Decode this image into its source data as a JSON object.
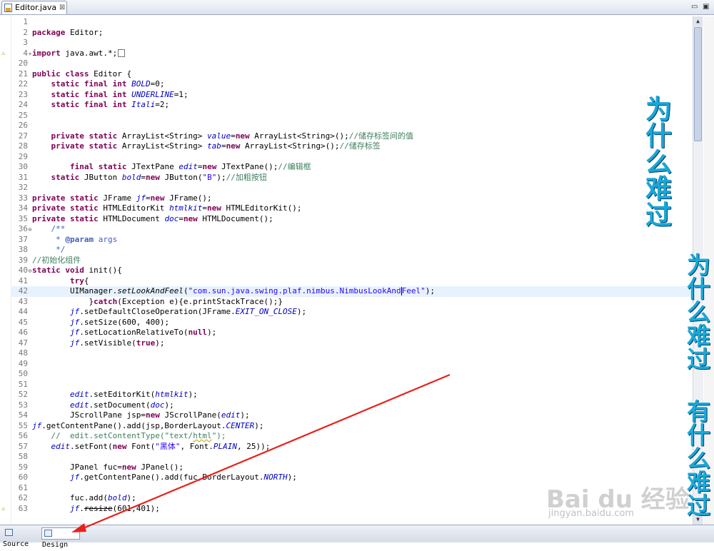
{
  "tab": {
    "title": "Editor.java",
    "close": "⊠"
  },
  "window_controls": {
    "minimize": "▭",
    "maximize": "▣"
  },
  "code_lines": [
    {
      "n": "1",
      "html": ""
    },
    {
      "n": "2",
      "html": "<span class=\"kw\">package</span> Editor;"
    },
    {
      "n": "3",
      "html": ""
    },
    {
      "n": "4",
      "fold": "+",
      "marker": "⚠",
      "html": "<span class=\"kw\">import</span> java.awt.*;<span class=\"foldbox\"></span>"
    },
    {
      "n": "20",
      "html": ""
    },
    {
      "n": "21",
      "html": "<span class=\"kw\">public class</span> Editor {"
    },
    {
      "n": "22",
      "html": "    <span class=\"kw\">static final int</span> <span class=\"sf\">BOLD</span>=0;"
    },
    {
      "n": "23",
      "html": "    <span class=\"kw\">static final int</span> <span class=\"sf\">UNDERLINE</span>=1;"
    },
    {
      "n": "24",
      "html": "    <span class=\"kw\">static final int</span> <span class=\"sf\">Itali</span>=2;"
    },
    {
      "n": "25",
      "html": ""
    },
    {
      "n": "26",
      "html": ""
    },
    {
      "n": "27",
      "html": "    <span class=\"kw\">private static</span> ArrayList&lt;String&gt; <span class=\"sf\">value</span>=<span class=\"kw\">new</span> ArrayList&lt;String&gt;();<span class=\"cm\">//储存标签间的值</span>"
    },
    {
      "n": "28",
      "html": "    <span class=\"kw\">private static</span> ArrayList&lt;String&gt; <span class=\"sf\">tab</span>=<span class=\"kw\">new</span> ArrayList&lt;String&gt;();<span class=\"cm\">//储存标签</span>"
    },
    {
      "n": "29",
      "html": ""
    },
    {
      "n": "30",
      "html": "        <span class=\"kw\">final static</span> JTextPane <span class=\"sf\">edit</span>=<span class=\"kw\">new</span> JTextPane();<span class=\"cm\">//编辑框</span>"
    },
    {
      "n": "31",
      "html": "    <span class=\"kw\">static</span> JButton <span class=\"sf\">bold</span>=<span class=\"kw\">new</span> JButton(<span class=\"str\">\"B\"</span>);<span class=\"cm\">//加粗按钮</span>"
    },
    {
      "n": "32",
      "html": ""
    },
    {
      "n": "33",
      "html": "<span class=\"kw\">private static</span> JFrame <span class=\"sf\">jf</span>=<span class=\"kw\">new</span> JFrame();"
    },
    {
      "n": "34",
      "html": "<span class=\"kw\">private static</span> HTMLEditorKit <span class=\"sf\">htmlkit</span>=<span class=\"kw\">new</span> HTMLEditorKit();"
    },
    {
      "n": "35",
      "html": "<span class=\"kw\">private static</span> HTMLDocument <span class=\"sf\">doc</span>=<span class=\"kw\">new</span> HTMLDocument();"
    },
    {
      "n": "36",
      "fold": "⊖",
      "html": "    <span class=\"jd\">/**</span>"
    },
    {
      "n": "37",
      "html": "     <span class=\"jd\">* <b>@param</b> args</span>"
    },
    {
      "n": "38",
      "html": "     <span class=\"jd\">*/</span>"
    },
    {
      "n": "39",
      "html": "<span class=\"cm\">//初始化组件</span>"
    },
    {
      "n": "40",
      "fold": "⊖",
      "html": "<span class=\"kw\">static void</span> init(){"
    },
    {
      "n": "41",
      "html": "        <span class=\"kw\">try</span>{"
    },
    {
      "n": "42",
      "cur": true,
      "html": "        UIManager.<i>setLookAndFeel</i>(<span class=\"str\">\"com.sun.java.swing.plaf.nimbus.NimbusLookAnd<span class=\"caret\"></span>Feel\"</span>);"
    },
    {
      "n": "43",
      "html": "            }<span class=\"kw\">catch</span>(Exception e){e.printStackTrace();}"
    },
    {
      "n": "44",
      "html": "        <span class=\"sf\">jf</span>.setDefaultCloseOperation(JFrame.<span class=\"sf\">EXIT_ON_CLOSE</span>);"
    },
    {
      "n": "45",
      "html": "        <span class=\"sf\">jf</span>.setSize(600, 400);"
    },
    {
      "n": "46",
      "html": "        <span class=\"sf\">jf</span>.setLocationRelativeTo(<span class=\"kw\">null</span>);"
    },
    {
      "n": "47",
      "html": "        <span class=\"sf\">jf</span>.setVisible(<span class=\"kw\">true</span>);"
    },
    {
      "n": "48",
      "html": ""
    },
    {
      "n": "49",
      "html": ""
    },
    {
      "n": "50",
      "html": ""
    },
    {
      "n": "51",
      "html": ""
    },
    {
      "n": "52",
      "html": "        <span class=\"sf\">edit</span>.setEditorKit(<span class=\"sf\">htmlkit</span>);"
    },
    {
      "n": "53",
      "html": "        <span class=\"sf\">edit</span>.setDocument(<span class=\"sf\">doc</span>);"
    },
    {
      "n": "54",
      "html": "        JScrollPane jsp=<span class=\"kw\">new</span> JScrollPane(<span class=\"sf\">edit</span>);"
    },
    {
      "n": "55",
      "html": "<span class=\"sf\">jf</span>.getContentPane().add(jsp,BorderLayout.<span class=\"sf\">CENTER</span>);"
    },
    {
      "n": "56",
      "html": "    <span class=\"cm\">//  edit.setContentType(\"text/<span class=\"warn\">html</span>\");</span>"
    },
    {
      "n": "57",
      "html": "    <span class=\"sf\">edit</span>.setFont(<span class=\"kw\">new</span> Font(<span class=\"str\">\"黑体\"</span>, Font.<span class=\"sf\">PLAIN</span>, 25));"
    },
    {
      "n": "58",
      "html": ""
    },
    {
      "n": "59",
      "html": "        JPanel fuc=<span class=\"kw\">new</span> JPanel();"
    },
    {
      "n": "60",
      "html": "        <span class=\"sf\">jf</span>.getContentPane().add(fuc,BorderLayout.<span class=\"sf\">NORTH</span>);"
    },
    {
      "n": "61",
      "html": ""
    },
    {
      "n": "62",
      "html": "        fuc.add(<span class=\"sf\">bold</span>);"
    },
    {
      "n": "63",
      "marker": "⚠",
      "html": "        <span class=\"sf\">jf</span>.<span class=\"strike warn\">resize</span>(601,401);"
    }
  ],
  "bottom_tabs": [
    {
      "label": "Source",
      "active": false
    },
    {
      "label": "Design",
      "active": true
    }
  ],
  "overlay": {
    "text1": "为什么难过",
    "text2": "为什么难过",
    "text3": "有什么难过"
  },
  "watermark": {
    "logo": "Bai du 经验",
    "url": "jingyan.baidu.com"
  },
  "colors": {
    "keyword": "#7f0055",
    "comment": "#3f7f5f",
    "string": "#2a00ff",
    "field": "#0000c0",
    "overlay_text": "#19a7d6",
    "arrow": "#e8201a"
  }
}
